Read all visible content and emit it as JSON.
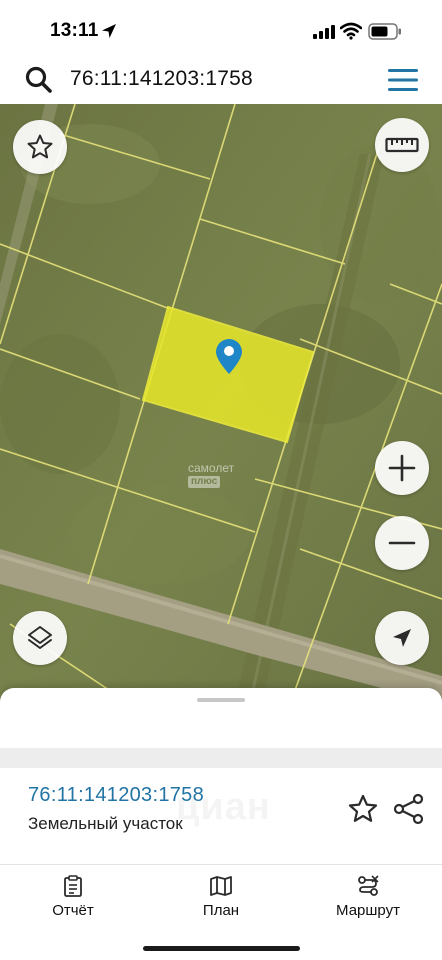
{
  "status_bar": {
    "time": "13:11",
    "icons": [
      "location-arrow-icon",
      "cellular-signal-icon",
      "wifi-icon",
      "battery-icon"
    ]
  },
  "search": {
    "value": "76:11:141203:1758",
    "icon": "search-icon",
    "menu_icon": "hamburger-menu-icon"
  },
  "map": {
    "type": "satellite",
    "watermark_line1": "самолет",
    "watermark_line2": "плюс",
    "controls": {
      "favorite": "star-icon",
      "ruler": "ruler-icon",
      "zoom_in": "plus-icon",
      "zoom_out": "minus-icon",
      "layers": "layers-icon",
      "locate": "navigation-arrow-icon"
    },
    "selected_parcel_color": "#e8e82a",
    "boundary_color": "#e6e27a",
    "marker_color": "#1f86c7"
  },
  "parcel": {
    "number": "76:11:141203:1758",
    "type": "Земельный участок",
    "number_color": "#2274a5",
    "card_watermark": "циан"
  },
  "tabs": [
    {
      "label": "Отчёт",
      "icon": "report-icon"
    },
    {
      "label": "План",
      "icon": "map-plan-icon"
    },
    {
      "label": "Маршрут",
      "icon": "route-icon"
    }
  ]
}
